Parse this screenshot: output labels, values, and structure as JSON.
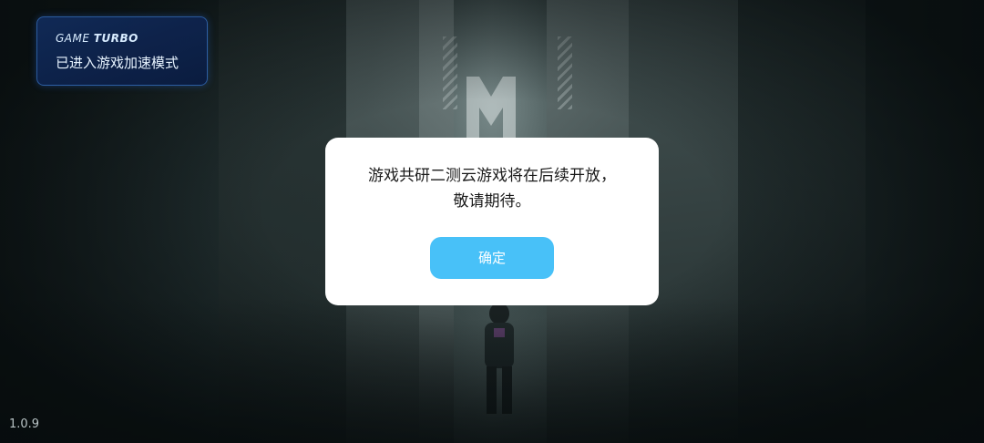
{
  "game_turbo": {
    "brand_prefix": "GAME",
    "brand_suffix": "TURBO",
    "message": "已进入游戏加速模式"
  },
  "dialog": {
    "line1": "游戏共研二测云游戏将在后续开放，",
    "line2": "敬请期待。",
    "confirm_label": "确定",
    "confirm_color": "#48c1f8"
  },
  "version": "1.0.9",
  "background": {
    "description_icon": "game-splash-art"
  }
}
